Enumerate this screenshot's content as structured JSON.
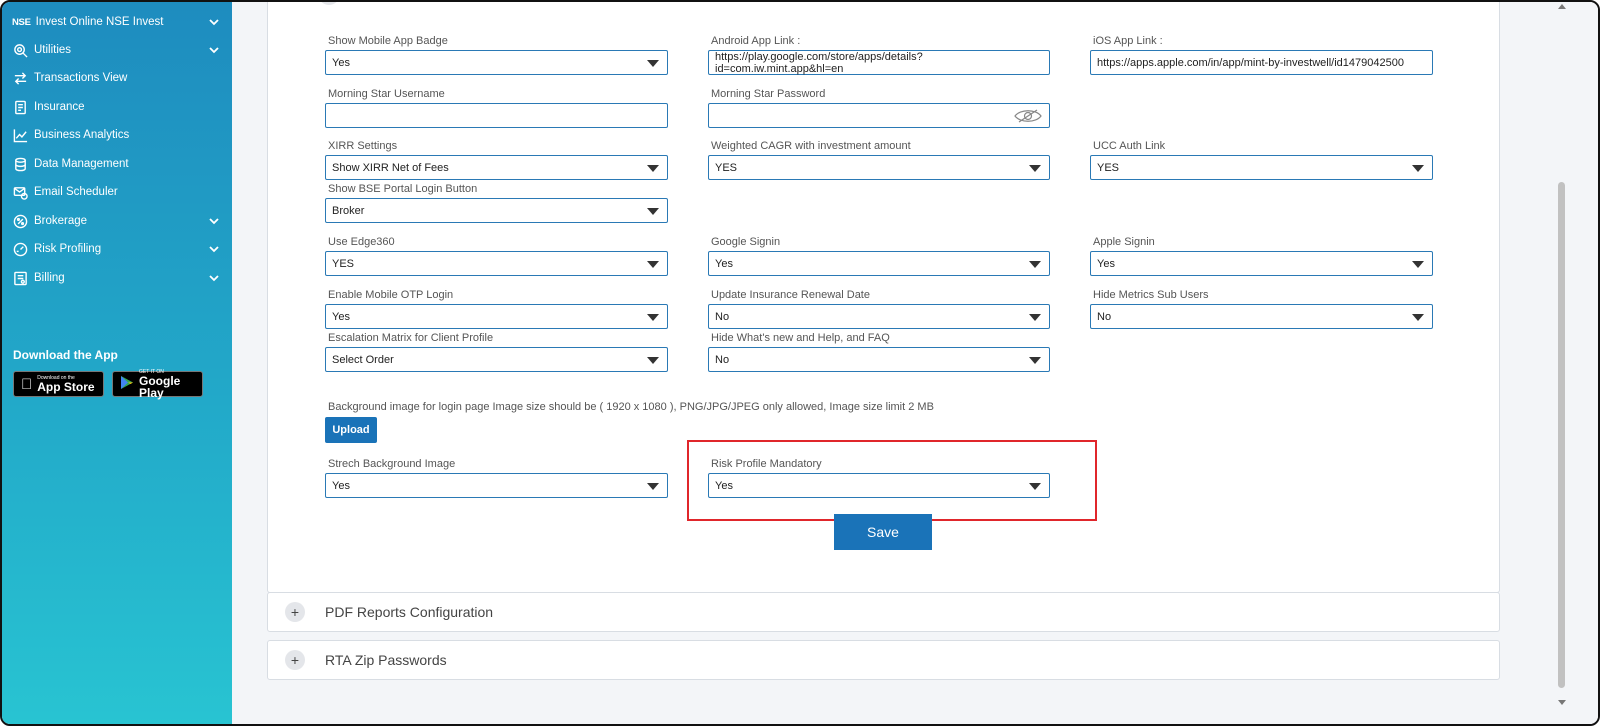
{
  "sidebar": {
    "items": [
      {
        "label": "Invest Online NSE Invest",
        "prefix": "NSE",
        "icon": "nse-logo-icon",
        "has_chevron": true
      },
      {
        "label": "Utilities",
        "icon": "utilities-search-icon",
        "has_chevron": true
      },
      {
        "label": "Transactions View",
        "icon": "transfer-arrows-icon",
        "has_chevron": false
      },
      {
        "label": "Insurance",
        "icon": "document-icon",
        "has_chevron": false
      },
      {
        "label": "Business Analytics",
        "icon": "chart-line-icon",
        "has_chevron": false
      },
      {
        "label": "Data Management",
        "icon": "database-icon",
        "has_chevron": false
      },
      {
        "label": "Email Scheduler",
        "icon": "email-clock-icon",
        "has_chevron": false
      },
      {
        "label": "Brokerage",
        "icon": "percent-icon",
        "has_chevron": true
      },
      {
        "label": "Risk Profiling",
        "icon": "gauge-icon",
        "has_chevron": true
      },
      {
        "label": "Billing",
        "icon": "bill-icon",
        "has_chevron": true
      }
    ],
    "download_title": "Download the App",
    "app_store": {
      "small": "Download on the",
      "big": "App Store"
    },
    "google_play": {
      "small": "GET IT ON",
      "big": "Google Play"
    }
  },
  "form": {
    "show_mobile_app_badge": {
      "label": "Show Mobile App Badge",
      "value": "Yes"
    },
    "android_app_link": {
      "label": "Android App Link :",
      "value": "https://play.google.com/store/apps/details?id=com.iw.mint.app&hl=en"
    },
    "ios_app_link": {
      "label": "iOS App Link :",
      "value": "https://apps.apple.com/in/app/mint-by-investwell/id1479042500"
    },
    "morning_star_username": {
      "label": "Morning Star Username",
      "value": ""
    },
    "morning_star_password": {
      "label": "Morning Star Password",
      "value": ""
    },
    "xirr_settings": {
      "label": "XIRR Settings",
      "value": "Show XIRR Net of Fees"
    },
    "weighted_cagr": {
      "label": "Weighted CAGR with investment amount",
      "value": "YES"
    },
    "ucc_auth_link": {
      "label": "UCC Auth Link",
      "value": "YES"
    },
    "show_bse_portal": {
      "label": "Show BSE Portal Login Button",
      "value": "Broker"
    },
    "use_edge360": {
      "label": "Use Edge360",
      "value": "YES"
    },
    "google_signin": {
      "label": "Google Signin",
      "value": "Yes"
    },
    "apple_signin": {
      "label": "Apple Signin",
      "value": "Yes"
    },
    "enable_mobile_otp": {
      "label": "Enable Mobile OTP Login",
      "value": "Yes"
    },
    "update_insurance_renewal": {
      "label": "Update Insurance Renewal Date",
      "value": "No"
    },
    "hide_metrics_sub_users": {
      "label": "Hide Metrics Sub Users",
      "value": "No"
    },
    "escalation_matrix": {
      "label": "Escalation Matrix for Client Profile",
      "value": "Select Order"
    },
    "hide_whats_new": {
      "label": "Hide What's new and Help, and FAQ",
      "value": "No"
    },
    "background_help": "Background image for login page Image size should be ( 1920 x 1080 ), PNG/JPG/JPEG only allowed, Image size limit 2 MB",
    "upload_label": "Upload",
    "stretch_background": {
      "label": "Strech Background Image",
      "value": "Yes"
    },
    "risk_profile_mandatory": {
      "label": "Risk Profile Mandatory",
      "value": "Yes"
    },
    "save_label": "Save"
  },
  "accordions": [
    {
      "title": "PDF Reports Configuration",
      "toggle": "+"
    },
    {
      "title": "RTA Zip Passwords",
      "toggle": "+"
    }
  ],
  "colors": {
    "primary": "#1a73b8",
    "highlight": "#e0262b",
    "sidebar_top": "#1e8cbf",
    "sidebar_bottom": "#28c4d2"
  }
}
